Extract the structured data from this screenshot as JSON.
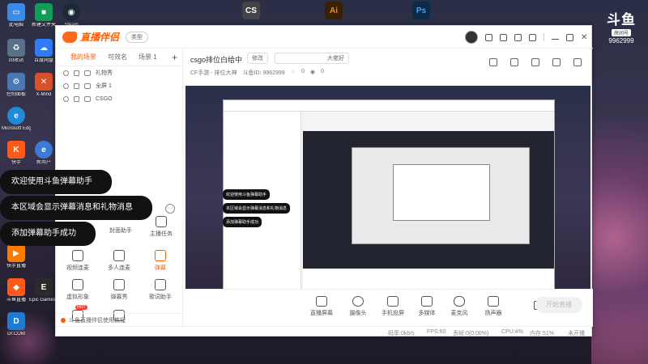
{
  "desktop": {
    "icons": [
      {
        "label": "此电脑",
        "color": "#3c8ce7"
      },
      {
        "label": "新建文件夹",
        "color": "#0f9d58"
      },
      {
        "label": "Steam",
        "color": "#1b2838"
      },
      {
        "label": "回收站",
        "color": "#5a6f8a"
      },
      {
        "label": "百度网盘",
        "color": "#2e7cf6"
      },
      {
        "label": "控制面板",
        "color": "#4a78b5"
      },
      {
        "label": "X-Mind",
        "color": "#d9502b"
      },
      {
        "label": "Microsoft Edge",
        "color": "#1e8ad8"
      },
      {
        "label": "快手",
        "color": "#ff5a1a"
      },
      {
        "label": "新用户",
        "color": "#3a7bd5"
      },
      {
        "label": "快手直播",
        "color": "#ff7a00"
      },
      {
        "label": "Epic Games Launcher",
        "color": "#2b2b2b"
      },
      {
        "label": "斗鱼直播",
        "color": "#ff5a1a"
      },
      {
        "label": "Dr.COM",
        "color": "#1f7ad1"
      }
    ],
    "taskbar_top": [
      {
        "label": "CS",
        "color": "#444"
      },
      {
        "label": "Ai",
        "color": "#ff8c1a"
      },
      {
        "label": "Ps",
        "color": "#1e90ff"
      }
    ],
    "brand_logo": "斗鱼",
    "brand_room": "房间号",
    "brand_number": "9962999"
  },
  "app": {
    "name": "直播伴侣",
    "type_tag": "类型",
    "scene_tabs": [
      "我的场景",
      "可效名",
      "场景 1"
    ],
    "sources": [
      "礼物秀",
      "全屏 1",
      "CSGO"
    ],
    "tools": [
      {
        "label": "视频连麦",
        "icon": "video-call-icon"
      },
      {
        "label": "多人连麦",
        "icon": "multi-call-icon"
      },
      {
        "label": "弹幕",
        "icon": "danmu-icon",
        "active": true
      },
      {
        "label": "虚拟形象",
        "icon": "avatar-icon"
      },
      {
        "label": "弹幕秀",
        "icon": "danmu-show-icon"
      },
      {
        "label": "歌词助手",
        "icon": "lyrics-icon"
      }
    ],
    "tools_top": [
      "封面助手",
      "主播任务"
    ],
    "hot_badge": "HOT",
    "tutorial": "斗鱼直播伴侣使用教程",
    "room": {
      "title": "csgo排位白给中",
      "edit_label": "修改",
      "notice": "大佬好",
      "category": "CF手游 - 排位大神",
      "id_label": "斗鱼ID: 9962999",
      "likes": "0",
      "viewers": "0"
    },
    "controls": [
      "直播屏幕",
      "摄像头",
      "手机投屏",
      "多媒体",
      "麦克风",
      "扬声器"
    ],
    "start_button": "开始直播",
    "status": {
      "bitrate": "码率:0kb/s",
      "fps": "FPS:60",
      "drop": "丢帧:0(0.00%)",
      "cpu": "CPU:4%",
      "memory": "内存:51%",
      "state": "未开播"
    }
  },
  "toasts": [
    "欢迎使用斗鱼弹幕助手",
    "本区域会显示弹幕消息和礼物消息",
    "添加弹幕助手成功"
  ]
}
